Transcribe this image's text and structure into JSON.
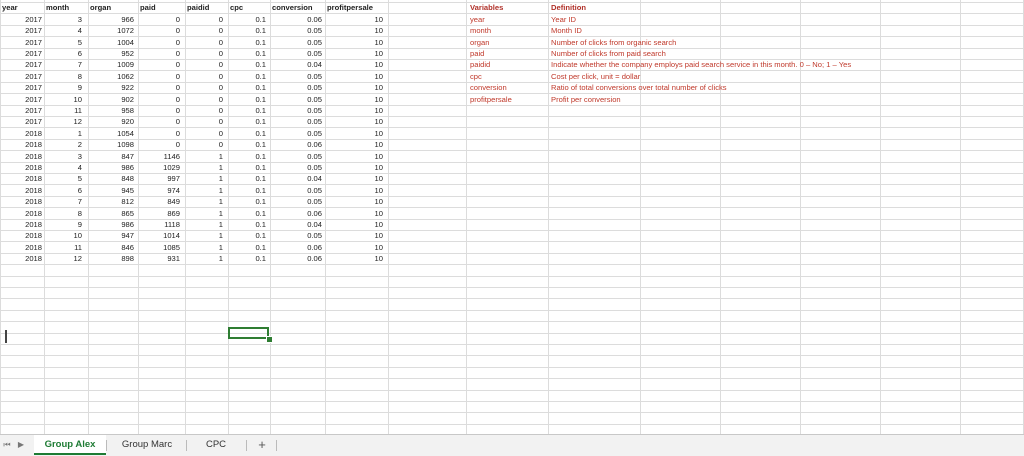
{
  "headers": [
    "year",
    "month",
    "organ",
    "paid",
    "paidid",
    "cpc",
    "conversion",
    "profitpersale"
  ],
  "rows": [
    [
      "2017",
      "3",
      "966",
      "0",
      "0",
      "0.1",
      "0.06",
      "10"
    ],
    [
      "2017",
      "4",
      "1072",
      "0",
      "0",
      "0.1",
      "0.05",
      "10"
    ],
    [
      "2017",
      "5",
      "1004",
      "0",
      "0",
      "0.1",
      "0.05",
      "10"
    ],
    [
      "2017",
      "6",
      "952",
      "0",
      "0",
      "0.1",
      "0.05",
      "10"
    ],
    [
      "2017",
      "7",
      "1009",
      "0",
      "0",
      "0.1",
      "0.04",
      "10"
    ],
    [
      "2017",
      "8",
      "1062",
      "0",
      "0",
      "0.1",
      "0.05",
      "10"
    ],
    [
      "2017",
      "9",
      "922",
      "0",
      "0",
      "0.1",
      "0.05",
      "10"
    ],
    [
      "2017",
      "10",
      "902",
      "0",
      "0",
      "0.1",
      "0.05",
      "10"
    ],
    [
      "2017",
      "11",
      "958",
      "0",
      "0",
      "0.1",
      "0.05",
      "10"
    ],
    [
      "2017",
      "12",
      "920",
      "0",
      "0",
      "0.1",
      "0.05",
      "10"
    ],
    [
      "2018",
      "1",
      "1054",
      "0",
      "0",
      "0.1",
      "0.05",
      "10"
    ],
    [
      "2018",
      "2",
      "1098",
      "0",
      "0",
      "0.1",
      "0.06",
      "10"
    ],
    [
      "2018",
      "3",
      "847",
      "1146",
      "1",
      "0.1",
      "0.05",
      "10"
    ],
    [
      "2018",
      "4",
      "986",
      "1029",
      "1",
      "0.1",
      "0.05",
      "10"
    ],
    [
      "2018",
      "5",
      "848",
      "997",
      "1",
      "0.1",
      "0.04",
      "10"
    ],
    [
      "2018",
      "6",
      "945",
      "974",
      "1",
      "0.1",
      "0.05",
      "10"
    ],
    [
      "2018",
      "7",
      "812",
      "849",
      "1",
      "0.1",
      "0.05",
      "10"
    ],
    [
      "2018",
      "8",
      "865",
      "869",
      "1",
      "0.1",
      "0.06",
      "10"
    ],
    [
      "2018",
      "9",
      "986",
      "1118",
      "1",
      "0.1",
      "0.04",
      "10"
    ],
    [
      "2018",
      "10",
      "947",
      "1014",
      "1",
      "0.1",
      "0.05",
      "10"
    ],
    [
      "2018",
      "11",
      "846",
      "1085",
      "1",
      "0.1",
      "0.06",
      "10"
    ],
    [
      "2018",
      "12",
      "898",
      "931",
      "1",
      "0.1",
      "0.06",
      "10"
    ]
  ],
  "definitions": {
    "headers": [
      "Variables",
      "Definition"
    ],
    "rows": [
      [
        "year",
        "Year ID"
      ],
      [
        "month",
        "Month ID"
      ],
      [
        "organ",
        "Number of clicks from organic search"
      ],
      [
        "paid",
        "Number of clicks from paid search"
      ],
      [
        "paidid",
        "Indicate whether the company employs paid search service in this month. 0 – No; 1 – Yes"
      ],
      [
        "cpc",
        "Cost per click, unit = dollar"
      ],
      [
        "conversion",
        "Ratio of total conversions over total number of clicks"
      ],
      [
        "profitpersale",
        "Profit per conversion"
      ]
    ]
  },
  "sheet_tabs": [
    {
      "label": "Group Alex",
      "active": true
    },
    {
      "label": "Group Marc",
      "active": false
    },
    {
      "label": "CPC",
      "active": false
    }
  ],
  "add_sheet_label": "+",
  "colors": {
    "active_tab": "#1e7b34",
    "definition_text": "#c0392b",
    "selection": "#2e7d32"
  }
}
